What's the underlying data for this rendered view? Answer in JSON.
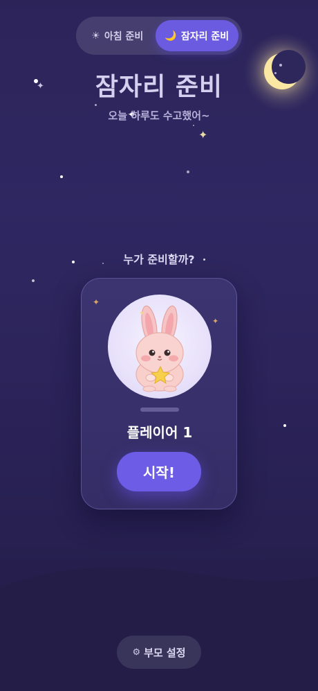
{
  "mode_toggle": {
    "morning": {
      "icon": "sun-icon",
      "glyph": "☀",
      "label": "아침 준비"
    },
    "bedtime": {
      "icon": "crescent-moon-icon",
      "glyph": "🌙",
      "label": "잠자리 준비"
    },
    "selected": "bedtime"
  },
  "header": {
    "title": "잠자리 준비",
    "subtitle": "오늘 하루도 수고했어~"
  },
  "player_select": {
    "prompt": "누가 준비할까?",
    "player": {
      "avatar": "bunny-holding-star",
      "name": "플레이어 1",
      "start_label": "시작!"
    }
  },
  "footer": {
    "gear_glyph": "⚙",
    "settings_label": "부모 설정"
  },
  "colors": {
    "background": "#2c2459",
    "accent": "#6b5be0",
    "moon": "#fbe7a4",
    "card": "#3a3270"
  }
}
